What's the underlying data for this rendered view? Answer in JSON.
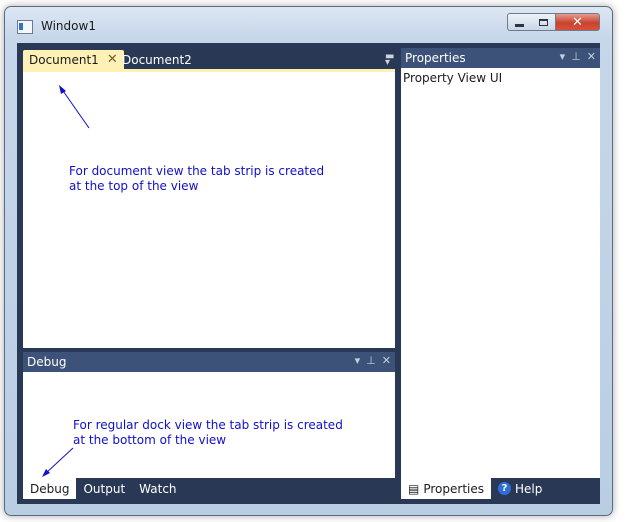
{
  "window": {
    "title": "Window1",
    "buttons": {
      "minimize": "minimize",
      "maximize": "maximize",
      "close": "✕"
    }
  },
  "document_group": {
    "tabs": [
      {
        "label": "Document1",
        "active": true
      },
      {
        "label": "Document2",
        "active": false
      }
    ],
    "note": "For document view the tab strip is created\nat the top of the view"
  },
  "debug_pane": {
    "title": "Debug",
    "note": "For regular dock view the tab strip is created\nat the bottom of the view",
    "tabs": [
      {
        "label": "Debug",
        "active": true
      },
      {
        "label": "Output",
        "active": false
      },
      {
        "label": "Watch",
        "active": false
      }
    ]
  },
  "properties_pane": {
    "title": "Properties",
    "content": "Property View UI",
    "tabs": [
      {
        "label": "Properties",
        "active": true
      },
      {
        "label": "Help",
        "active": false
      }
    ]
  },
  "colors": {
    "dock_background": "#293955",
    "active_document_tab": "#fff0b5",
    "pane_header": "#3d5278",
    "annotation_text": "#1010c8"
  }
}
